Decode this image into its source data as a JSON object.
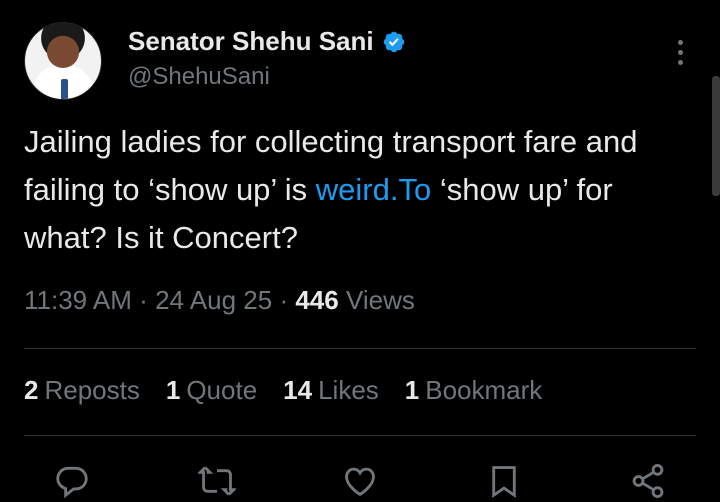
{
  "author": {
    "display_name": "Senator Shehu Sani",
    "handle": "@ShehuSani",
    "verified": true
  },
  "tweet": {
    "text_before_link": "Jailing ladies for collecting transport fare and failing to ‘show up’ is ",
    "link_text": "weird.To",
    "text_after_link": " ‘show up’ for what? Is it Concert?"
  },
  "meta": {
    "time": "11:39 AM",
    "separator": "·",
    "date": "24 Aug 25",
    "views_count": "446",
    "views_label": "Views"
  },
  "stats": {
    "reposts_count": "2",
    "reposts_label": "Reposts",
    "quotes_count": "1",
    "quotes_label": "Quote",
    "likes_count": "14",
    "likes_label": "Likes",
    "bookmarks_count": "1",
    "bookmarks_label": "Bookmark"
  },
  "icons": {
    "more": "more-options-icon",
    "reply": "reply-icon",
    "repost": "repost-icon",
    "like": "heart-icon",
    "bookmark": "bookmark-icon",
    "share": "share-icon",
    "verified": "verified-badge-icon"
  },
  "colors": {
    "background": "#000000",
    "text": "#e7e9ea",
    "secondary": "#71767b",
    "link": "#1d9bf0",
    "divider": "#2f3336"
  }
}
